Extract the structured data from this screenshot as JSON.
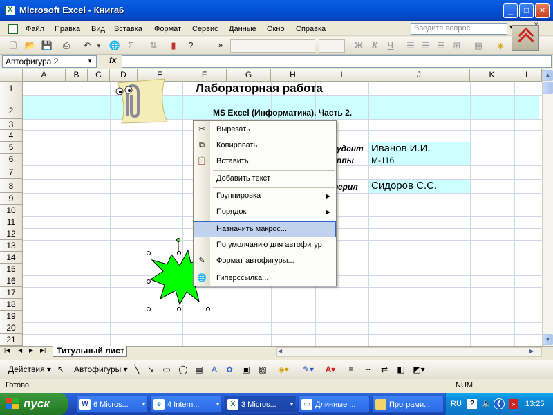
{
  "window": {
    "title": "Microsoft Excel - Книга6",
    "min": "_",
    "max": "□",
    "close": "✕"
  },
  "menu": [
    "Файл",
    "Правка",
    "Вид",
    "Вставка",
    "Формат",
    "Сервис",
    "Данные",
    "Окно",
    "Справка"
  ],
  "help_placeholder": "Введите вопрос",
  "toolbar": {
    "more": "»",
    "bold": "Ж",
    "italic": "К",
    "underline": "Ч"
  },
  "formula_bar": {
    "name_box": "Автофигура 2",
    "fx": "fx"
  },
  "columns": [
    "A",
    "B",
    "C",
    "D",
    "E",
    "F",
    "G",
    "H",
    "I",
    "J",
    "K",
    "L"
  ],
  "rows": [
    "1",
    "2",
    "3",
    "4",
    "5",
    "6",
    "7",
    "8",
    "9",
    "10",
    "11",
    "12",
    "13",
    "14",
    "15",
    "16",
    "17",
    "18",
    "19",
    "20",
    "21"
  ],
  "cells": {
    "title": "Лабораторная работа",
    "subtitle": "MS Excel (Информатика). Часть 2.",
    "student_label": "удент",
    "student_name": "Иванов И.И.",
    "group_label": "ппы",
    "group_value": "М-116",
    "checker_label": "верил",
    "checker_name": "Сидоров С.С."
  },
  "context_menu": {
    "cut": "Вырезать",
    "copy": "Копировать",
    "paste": "Вставить",
    "add_text": "Добавить текст",
    "grouping": "Группировка",
    "order": "Порядок",
    "assign_macro": "Назначить макрос...",
    "default_autoshape": "По умолчанию для автофигур",
    "format_autoshape": "Формат автофигуры...",
    "hyperlink": "Гиперссылка..."
  },
  "sheet_tab": "Титульный лист",
  "draw_toolbar": {
    "actions": "Действия ▾",
    "autoshapes": "Автофигуры ▾"
  },
  "status": {
    "ready": "Готово",
    "num": "NUM"
  },
  "taskbar": {
    "start": "пуск",
    "tasks": [
      "6 Micros...",
      "4 Intern...",
      "3 Micros...",
      "Длинные ...",
      "Програми..."
    ],
    "lang": "RU",
    "time": "13:25"
  },
  "colors": {
    "cell_fill": "#ccffff",
    "star": "#00ff00",
    "highlight": "#c1d2ee"
  }
}
